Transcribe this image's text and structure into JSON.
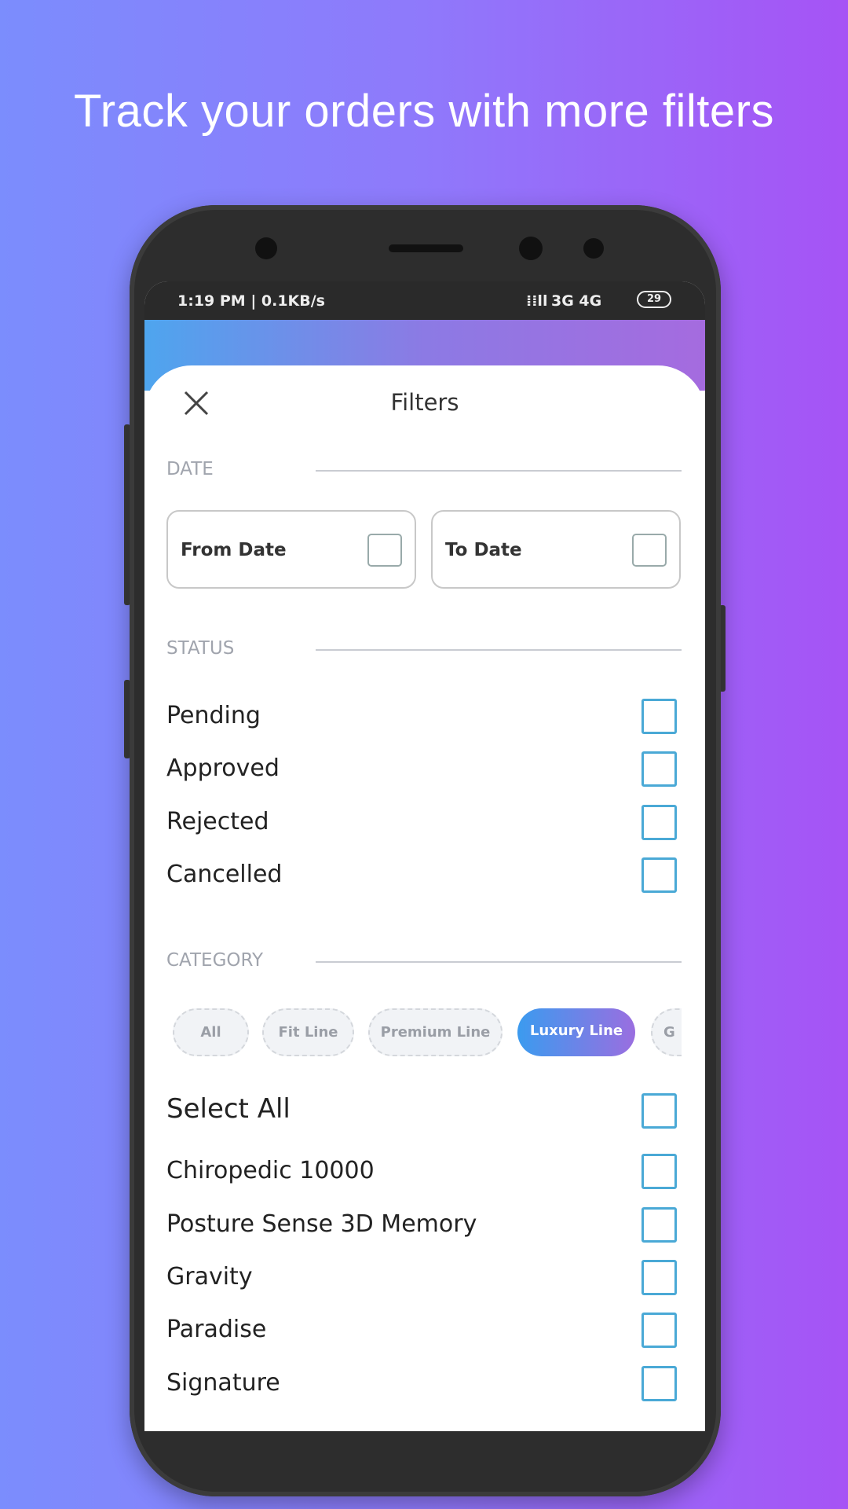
{
  "headline": "Track your orders with more filters",
  "status_bar": {
    "left": "1:19 PM | 0.1KB/s",
    "right": "3G 4G",
    "battery": "29"
  },
  "filters": {
    "title": "Filters",
    "date_section": "DATE",
    "from_date": "From Date",
    "to_date": "To Date",
    "status_section": "STATUS",
    "statuses": [
      "Pending",
      "Approved",
      "Rejected",
      "Cancelled"
    ],
    "category_section": "CATEGORY",
    "chips": [
      "All",
      "Fit Line",
      "Premium Line",
      "Luxury Line",
      "G"
    ],
    "selected_chip": "Luxury Line",
    "select_all": "Select All",
    "products": [
      "Chiropedic 10000",
      "Posture Sense 3D Memory",
      "Gravity",
      "Paradise",
      "Signature"
    ]
  },
  "colors": {
    "accent": "#4aa9d6",
    "chip_gradient_start": "#3b9bef",
    "chip_gradient_end": "#9a6ee0"
  }
}
